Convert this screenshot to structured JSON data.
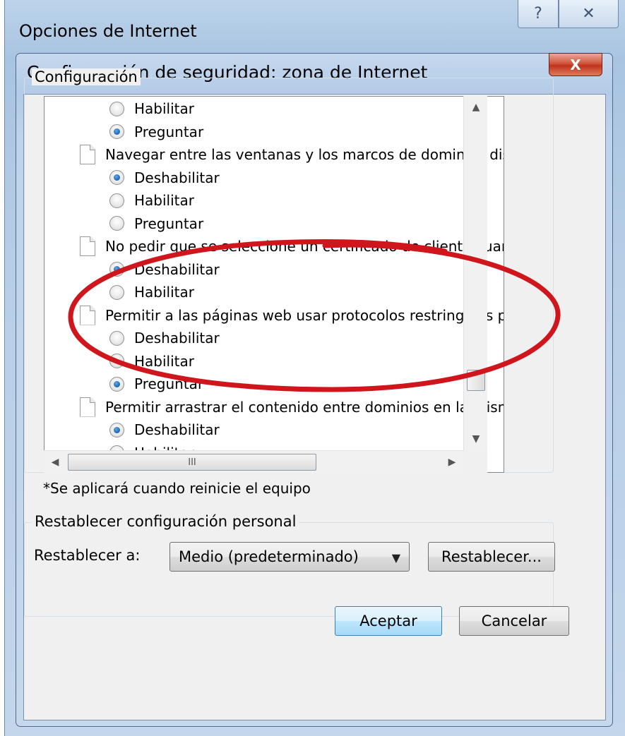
{
  "outer_window": {
    "title": "Opciones de Internet",
    "help_label": "?",
    "close_label": "✕"
  },
  "dialog": {
    "title": "Configuración de seguridad: zona de Internet",
    "close_label": "X"
  },
  "settings_group": {
    "legend": "Configuración",
    "rows": [
      {
        "kind": "option",
        "label": "Habilitar",
        "checked": false
      },
      {
        "kind": "option",
        "label": "Preguntar",
        "checked": true
      },
      {
        "kind": "setting",
        "label": "Navegar entre las ventanas y los marcos de dominios distinto"
      },
      {
        "kind": "option",
        "label": "Deshabilitar",
        "checked": true
      },
      {
        "kind": "option",
        "label": "Habilitar",
        "checked": false
      },
      {
        "kind": "option",
        "label": "Preguntar",
        "checked": false
      },
      {
        "kind": "setting",
        "label": "No pedir que se seleccione un certificado de cliente cuando e"
      },
      {
        "kind": "option",
        "label": "Deshabilitar",
        "checked": true
      },
      {
        "kind": "option",
        "label": "Habilitar",
        "checked": false
      },
      {
        "kind": "setting",
        "label": "Permitir a las páginas web usar protocolos restringidos para e"
      },
      {
        "kind": "option",
        "label": "Deshabilitar",
        "checked": false
      },
      {
        "kind": "option",
        "label": "Habilitar",
        "checked": false
      },
      {
        "kind": "option",
        "label": "Preguntar",
        "checked": true
      },
      {
        "kind": "setting",
        "label": "Permitir arrastrar el contenido entre dominios en la misma ven"
      },
      {
        "kind": "option",
        "label": "Deshabilitar",
        "checked": true
      },
      {
        "kind": "option",
        "label": "Habilitar",
        "checked": false
      }
    ],
    "hscroll_grip": "III",
    "note": "*Se aplicará cuando reinicie el equipo"
  },
  "reset_group": {
    "legend": "Restablecer configuración personal",
    "label": "Restablecer a:",
    "selected": "Medio (predeterminado)",
    "button": "Restablecer..."
  },
  "footer": {
    "accept": "Aceptar",
    "cancel": "Cancelar"
  },
  "colors": {
    "annotation": "#d0161d",
    "accept_border": "#3c7fb1"
  }
}
